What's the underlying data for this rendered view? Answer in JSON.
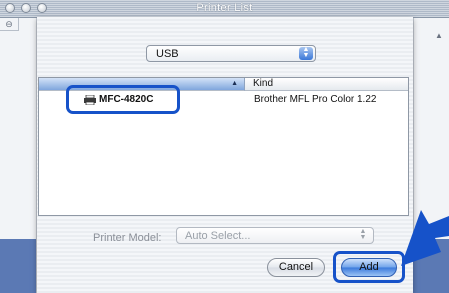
{
  "window": {
    "title": "Printer List"
  },
  "connection_popup": {
    "selected": "USB"
  },
  "printer_list": {
    "columns": {
      "name": "",
      "kind": "Kind"
    },
    "rows": [
      {
        "name": "MFC-4820C",
        "kind": "Brother MFL Pro Color 1.22"
      }
    ]
  },
  "printer_model": {
    "label": "Printer Model:",
    "value": "Auto Select..."
  },
  "buttons": {
    "cancel": "Cancel",
    "add": "Add"
  },
  "colors": {
    "highlight": "#1652c9",
    "accent": "#3a79db"
  }
}
